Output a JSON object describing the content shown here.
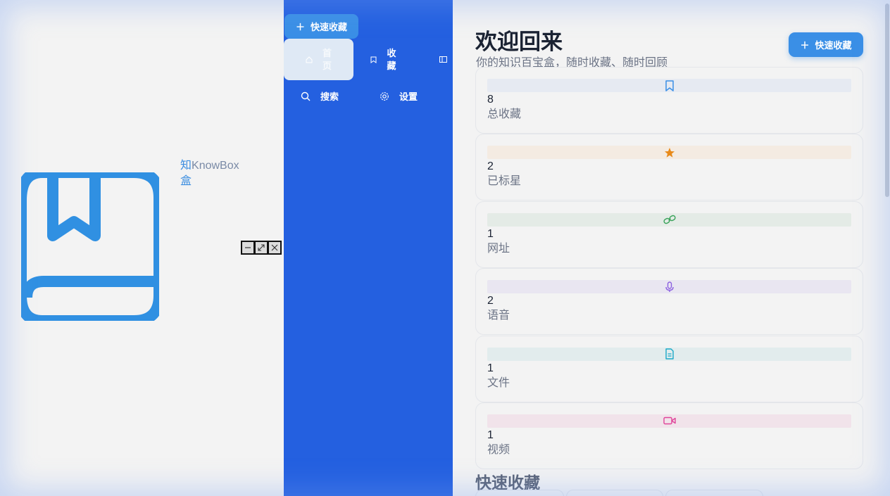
{
  "brand": {
    "name_zh_1": "知",
    "name_en": "KnowBox",
    "name_zh_2": "盒"
  },
  "nav": {
    "quick_label": "快速收藏",
    "items": [
      {
        "label": "首页",
        "icon": "home-icon",
        "active": true
      },
      {
        "label": "收藏",
        "icon": "bookmark-icon",
        "active": false
      },
      {
        "label": "搜索",
        "icon": "search-icon",
        "active": false
      },
      {
        "label": "设置",
        "icon": "gear-icon",
        "active": false
      }
    ]
  },
  "header": {
    "title": "欢迎回来",
    "subtitle": "你的知识百宝盒，随时收藏、随时回顾",
    "quick_label": "快速收藏"
  },
  "stats": [
    {
      "value": "8",
      "label": "总收藏",
      "icon": "bookmark-icon",
      "color": "#3a8fe6",
      "bg": "#e6eaf2"
    },
    {
      "value": "2",
      "label": "已标星",
      "icon": "star-icon",
      "color": "#e88a1a",
      "bg": "#f4ebe2"
    },
    {
      "value": "1",
      "label": "网址",
      "icon": "link-icon",
      "color": "#3aa35a",
      "bg": "#e4ebe6"
    },
    {
      "value": "2",
      "label": "语音",
      "icon": "mic-icon",
      "color": "#8b5fe0",
      "bg": "#e9e6f1"
    },
    {
      "value": "1",
      "label": "文件",
      "icon": "file-icon",
      "color": "#1aa9c8",
      "bg": "#e2eced"
    },
    {
      "value": "1",
      "label": "视频",
      "icon": "video-icon",
      "color": "#e0459a",
      "bg": "#f1e3ea"
    }
  ],
  "section": {
    "title": "快速收藏"
  }
}
